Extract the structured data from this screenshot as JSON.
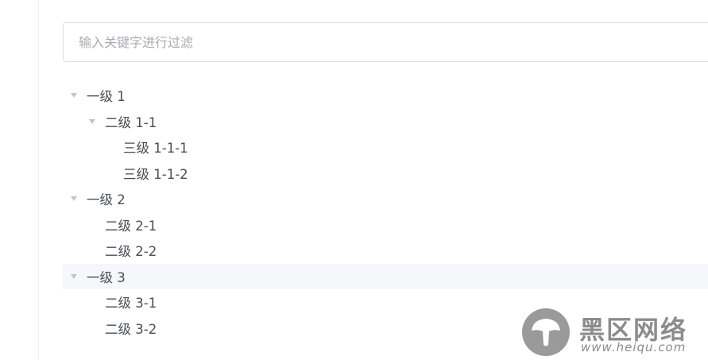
{
  "filter": {
    "placeholder": "输入关键字进行过滤",
    "value": ""
  },
  "tree": [
    {
      "label": "一级 1",
      "level": 1,
      "expandable": true,
      "expanded": true
    },
    {
      "label": "二级 1-1",
      "level": 2,
      "expandable": true,
      "expanded": true
    },
    {
      "label": "三级 1-1-1",
      "level": 3,
      "expandable": false
    },
    {
      "label": "三级 1-1-2",
      "level": 3,
      "expandable": false
    },
    {
      "label": "一级 2",
      "level": 1,
      "expandable": true,
      "expanded": true
    },
    {
      "label": "二级 2-1",
      "level": 2,
      "expandable": false
    },
    {
      "label": "二级 2-2",
      "level": 2,
      "expandable": false
    },
    {
      "label": "一级 3",
      "level": 1,
      "expandable": true,
      "expanded": true,
      "highlighted": true
    },
    {
      "label": "二级 3-1",
      "level": 2,
      "expandable": false
    },
    {
      "label": "二级 3-2",
      "level": 2,
      "expandable": false
    }
  ],
  "watermark": {
    "title": "黑区网络",
    "url": "www.heiqu.com",
    "logo_icon": "mushroom-logo-icon"
  },
  "colors": {
    "expand_icon": "#c0c4cc",
    "highlight_bg": "#f5f7fa",
    "border": "#dcdfe6"
  }
}
